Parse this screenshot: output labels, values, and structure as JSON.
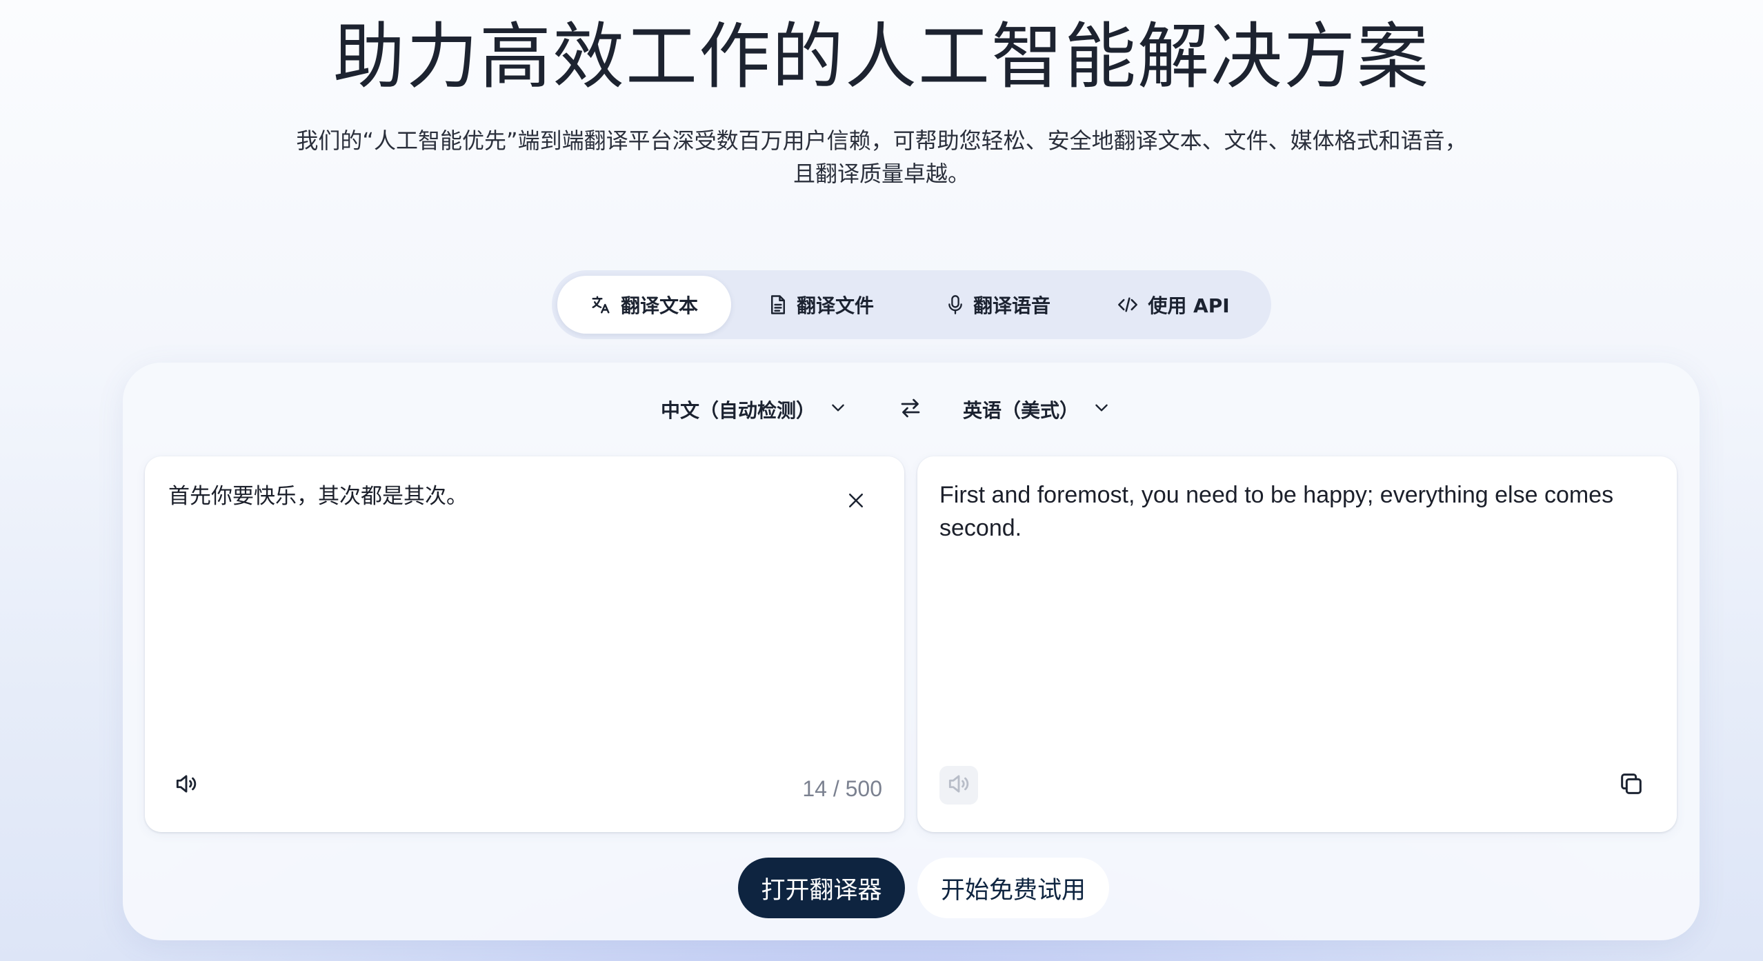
{
  "hero": {
    "title": "助力高效工作的人工智能解决方案",
    "subtitle": "我们的“人工智能优先”端到端翻译平台深受数百万用户信赖，可帮助您轻松、安全地翻译文本、文件、媒体格式和语音，且翻译质量卓越。"
  },
  "tabs": [
    {
      "label": "翻译文本",
      "icon": "translate-icon",
      "active": true
    },
    {
      "label": "翻译文件",
      "icon": "document-icon",
      "active": false
    },
    {
      "label": "翻译语音",
      "icon": "microphone-icon",
      "active": false
    },
    {
      "label": "使用 API",
      "icon": "code-icon",
      "active": false
    }
  ],
  "languages": {
    "source": "中文（自动检测）",
    "target": "英语（美式）",
    "swap_icon": "swap-icon",
    "dropdown_icon": "chevron-down-icon"
  },
  "source_panel": {
    "text": "首先你要快乐，其次都是其次。",
    "char_count": "14 / 500",
    "clear_icon": "close-icon",
    "speak_icon": "speaker-icon"
  },
  "target_panel": {
    "text": "First and foremost, you need to be happy; everything else comes second.",
    "speak_icon": "speaker-icon",
    "copy_icon": "copy-icon"
  },
  "actions": {
    "primary_label": "打开翻译器",
    "secondary_label": "开始免费试用"
  },
  "colors": {
    "primary_button": "#0e2440",
    "accent_text": "#1b2230",
    "muted_text": "#7b8190"
  }
}
